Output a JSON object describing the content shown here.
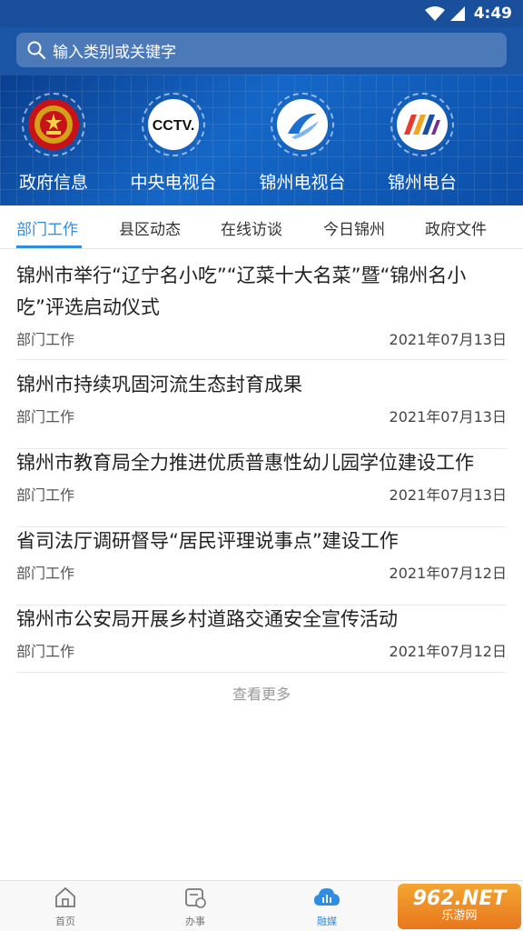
{
  "status_bar": {
    "time": "4:49"
  },
  "search": {
    "placeholder": "输入类别或关键字"
  },
  "channels": [
    {
      "label": "政府信息",
      "icon": "national-emblem-icon"
    },
    {
      "label": "中央电视台",
      "icon": "cctv-logo-icon"
    },
    {
      "label": "锦州电视台",
      "icon": "jinzhou-tv-logo-icon"
    },
    {
      "label": "锦州电台",
      "icon": "jinzhou-radio-logo-icon"
    }
  ],
  "tabs": [
    {
      "label": "部门工作",
      "active": true
    },
    {
      "label": "县区动态",
      "active": false
    },
    {
      "label": "在线访谈",
      "active": false
    },
    {
      "label": "今日锦州",
      "active": false
    },
    {
      "label": "政府文件",
      "active": false
    }
  ],
  "news": [
    {
      "title": "锦州市举行“辽宁名小吃”“辽菜十大名菜”暨“锦州名小吃”评选启动仪式",
      "category": "部门工作",
      "date": "2021年07月13日"
    },
    {
      "title": "锦州市持续巩固河流生态封育成果",
      "category": "部门工作",
      "date": "2021年07月13日"
    },
    {
      "title": "锦州市教育局全力推进优质普惠性幼儿园学位建设工作",
      "category": "部门工作",
      "date": "2021年07月13日"
    },
    {
      "title": "省司法厅调研督导“居民评理说事点”建设工作",
      "category": "部门工作",
      "date": "2021年07月12日"
    },
    {
      "title": "锦州市公安局开展乡村道路交通安全宣传活动",
      "category": "部门工作",
      "date": "2021年07月12日"
    }
  ],
  "more_label": "查看更多",
  "tabbar": [
    {
      "label": "首页",
      "icon": "home-icon",
      "active": false
    },
    {
      "label": "办事",
      "icon": "service-icon",
      "active": false
    },
    {
      "label": "融媒",
      "icon": "cloud-icon",
      "active": true
    }
  ],
  "watermark": {
    "line1": "962.NET",
    "line2": "乐游网"
  },
  "colors": {
    "header": "#1a55a6",
    "accent": "#2f8de4"
  }
}
